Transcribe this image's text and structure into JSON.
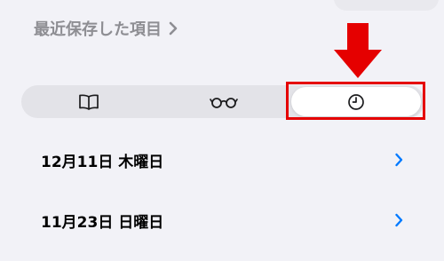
{
  "header": {
    "recent_label": "最近保存した項目",
    "chevron_icon": "chevron-right-icon"
  },
  "segmented_control": {
    "segments": [
      {
        "icon": "book-icon",
        "selected": false
      },
      {
        "icon": "glasses-icon",
        "selected": false
      },
      {
        "icon": "clock-icon",
        "selected": true
      }
    ]
  },
  "history": {
    "rows": [
      {
        "date": "12月11日 木曜日"
      },
      {
        "date": "11月23日 日曜日"
      }
    ]
  },
  "annotation": {
    "arrow_color": "#e50000",
    "box_color": "#e50000"
  },
  "colors": {
    "background": "#f2f2f7",
    "accent": "#007aff",
    "muted_text": "#8e8e93"
  }
}
